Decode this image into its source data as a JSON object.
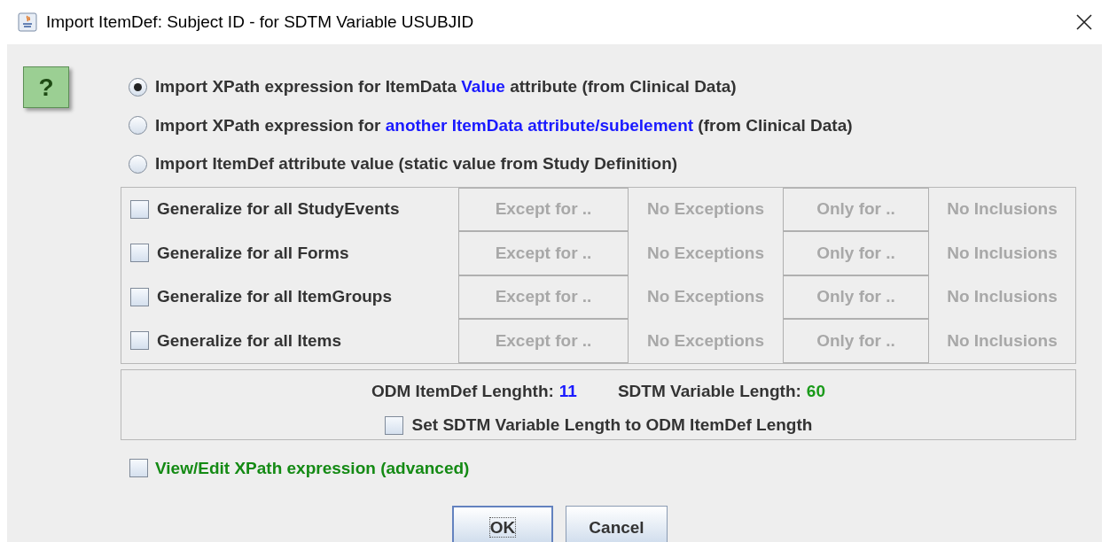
{
  "window": {
    "title": "Import ItemDef: Subject ID - for SDTM Variable USUBJID",
    "help": "?"
  },
  "options": [
    {
      "selected": true,
      "parts": [
        {
          "text": "Import XPath expression for ItemData ",
          "highlight": false
        },
        {
          "text": "Value",
          "highlight": true
        },
        {
          "text": " attribute (from Clinical Data)",
          "highlight": false
        }
      ]
    },
    {
      "selected": false,
      "parts": [
        {
          "text": "Import XPath expression for ",
          "highlight": false
        },
        {
          "text": "another ItemData attribute/subelement",
          "highlight": true
        },
        {
          "text": " (from Clinical Data)",
          "highlight": false
        }
      ]
    },
    {
      "selected": false,
      "parts": [
        {
          "text": "Import ItemDef attribute value (static value from Study Definition)",
          "highlight": false
        }
      ]
    }
  ],
  "generalize": [
    {
      "label": "Generalize for all StudyEvents",
      "checked": false,
      "disabled": true,
      "except_button": "Except for ..",
      "exceptions": "No Exceptions",
      "only_button": "Only for ..",
      "inclusions": "No Inclusions"
    },
    {
      "label": "Generalize for all Forms",
      "checked": false,
      "disabled": true,
      "except_button": "Except for ..",
      "exceptions": "No Exceptions",
      "only_button": "Only for ..",
      "inclusions": "No Inclusions"
    },
    {
      "label": "Generalize for all ItemGroups",
      "checked": false,
      "disabled": true,
      "except_button": "Except for ..",
      "exceptions": "No Exceptions",
      "only_button": "Only for ..",
      "inclusions": "No Inclusions"
    },
    {
      "label": "Generalize for all Items",
      "checked": false,
      "disabled": true,
      "except_button": "Except for ..",
      "exceptions": "No Exceptions",
      "only_button": "Only for ..",
      "inclusions": "No Inclusions"
    }
  ],
  "length": {
    "odm_label": "ODM ItemDef Lenghth:",
    "odm_value": "11",
    "sdtm_label": "SDTM Variable Length:",
    "sdtm_value": "60",
    "set_label": "Set SDTM Variable Length to ODM ItemDef Length",
    "set_checked": false
  },
  "advanced": {
    "label": "View/Edit XPath expression (advanced)",
    "checked": false
  },
  "buttons": [
    {
      "label": "OK",
      "focused": true
    },
    {
      "label": "Cancel",
      "focused": false
    }
  ]
}
